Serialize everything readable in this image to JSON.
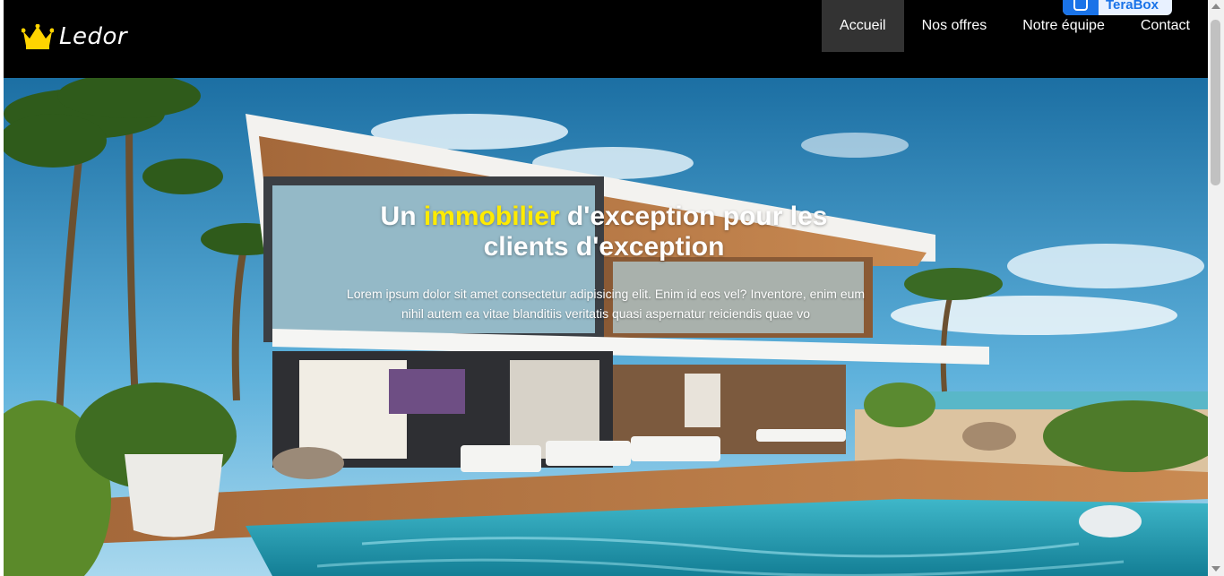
{
  "brand": {
    "name": "Ledor",
    "logo_icon": "crown-icon",
    "logo_color": "#ffd400"
  },
  "nav": {
    "items": [
      {
        "label": "Accueil",
        "active": true
      },
      {
        "label": "Nos offres",
        "active": false
      },
      {
        "label": "Notre équipe",
        "active": false
      },
      {
        "label": "Contact",
        "active": false
      }
    ]
  },
  "extension": {
    "label": "TeraBox",
    "icon": "terabox-icon"
  },
  "hero": {
    "title_before": "Un ",
    "title_highlight": "immobilier",
    "title_after": " d'exception pour les clients d'exception",
    "highlight_color": "#ffeb00",
    "text": "Lorem ipsum dolor sit amet consectetur adipisicing elit. Enim id eos vel? Inventore, enim eum nihil autem ea vitae blanditiis veritatis quasi aspernatur reiciendis quae vo",
    "background": "luxury-villa-pool-palm-trees-image"
  }
}
